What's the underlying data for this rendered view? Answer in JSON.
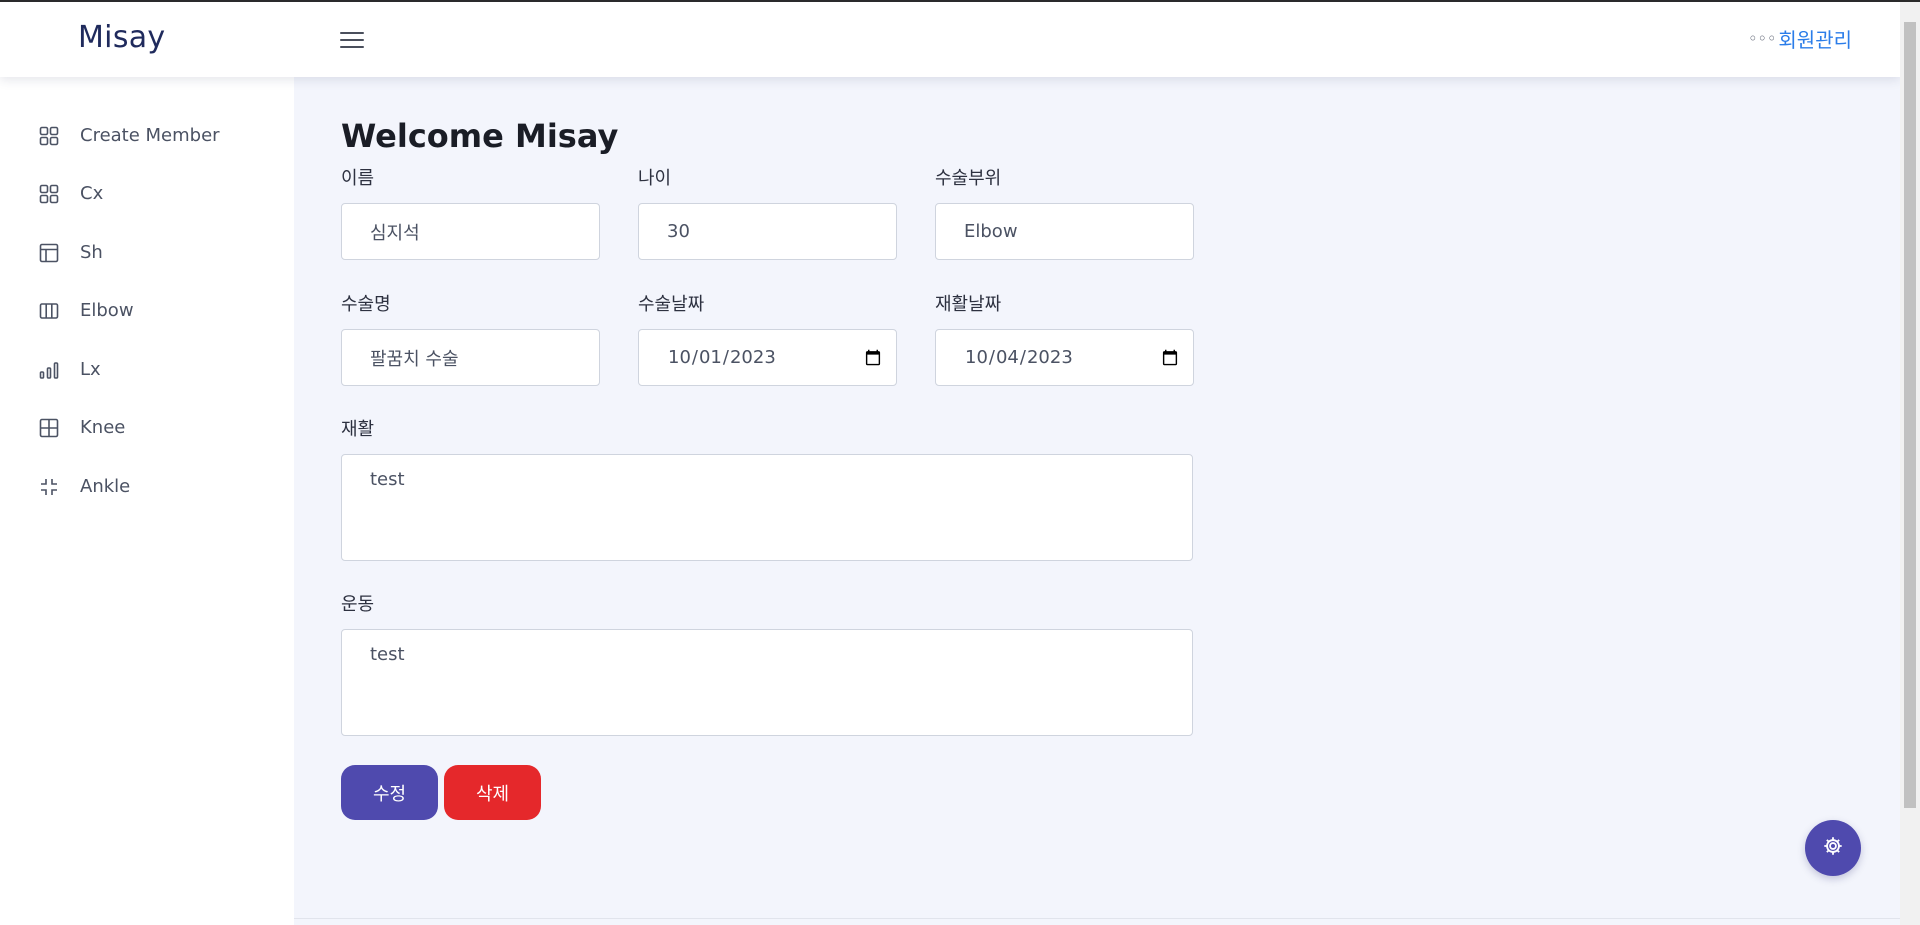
{
  "header": {
    "brand": "Misay",
    "member_menu_dots": "◦◦◦",
    "member_menu_label": "회원관리"
  },
  "sidebar": {
    "items": [
      {
        "label": "Create Member",
        "icon": "grid-icon"
      },
      {
        "label": "Cx",
        "icon": "grid-icon"
      },
      {
        "label": "Sh",
        "icon": "layout-icon"
      },
      {
        "label": "Elbow",
        "icon": "columns-icon"
      },
      {
        "label": "Lx",
        "icon": "bar-chart-icon"
      },
      {
        "label": "Knee",
        "icon": "table-icon"
      },
      {
        "label": "Ankle",
        "icon": "minimize-icon"
      }
    ]
  },
  "main": {
    "title": "Welcome Misay",
    "fields": {
      "name": {
        "label": "이름",
        "value": "심지석"
      },
      "age": {
        "label": "나이",
        "value": "30"
      },
      "surgery_site": {
        "label": "수술부위",
        "value": "Elbow"
      },
      "surgery_name": {
        "label": "수술명",
        "value": "팔꿈치 수술"
      },
      "surgery_date": {
        "label": "수술날짜",
        "value": "2023-10-01"
      },
      "rehab_date": {
        "label": "재활날짜",
        "value": "2023-10-04"
      },
      "rehab": {
        "label": "재활",
        "value": "test"
      },
      "exercise": {
        "label": "운동",
        "value": "test"
      }
    },
    "buttons": {
      "edit": "수정",
      "delete": "삭제"
    }
  },
  "colors": {
    "primary": "#4f4aae",
    "danger": "#e5282b",
    "link": "#2b7de9",
    "background": "#f3f5fc"
  },
  "floating": {
    "icon": "gear-icon"
  }
}
